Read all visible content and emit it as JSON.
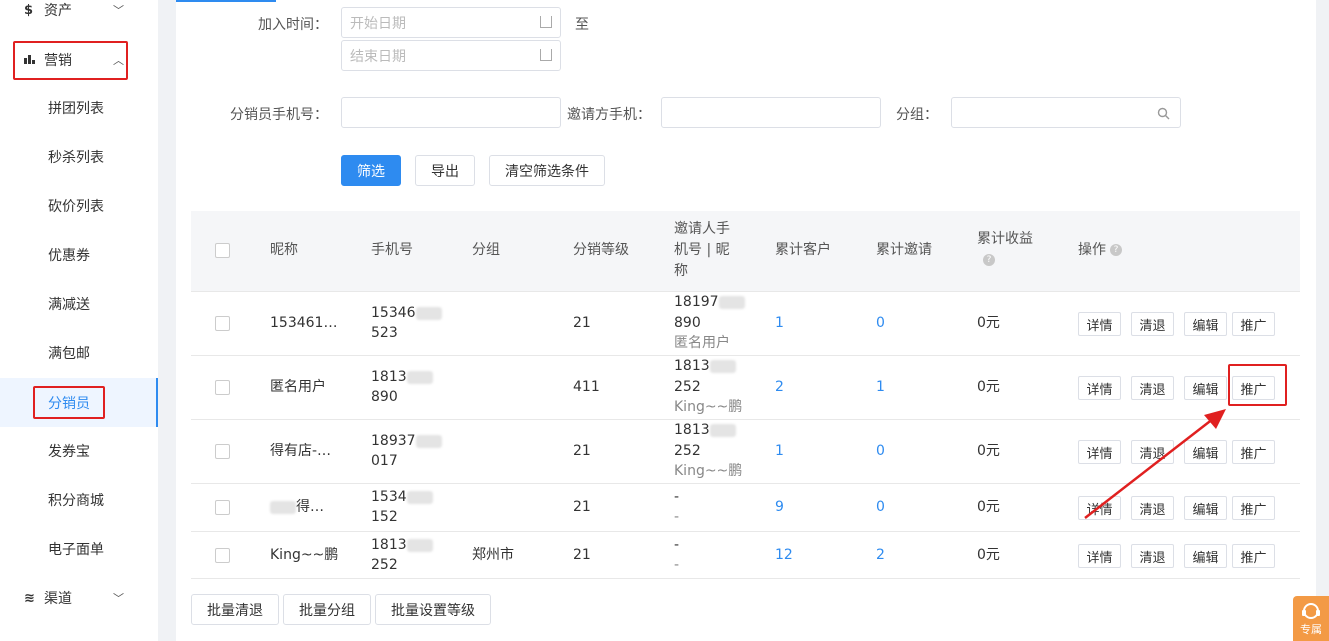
{
  "sidebar": {
    "top_items": [
      {
        "icon": "dollar-icon",
        "label": "资产",
        "expanded": false
      },
      {
        "icon": "bar-chart-icon",
        "label": "营销",
        "expanded": true
      },
      {
        "icon": "layers-icon",
        "label": "渠道",
        "expanded": false
      }
    ],
    "sub_items": [
      "拼团列表",
      "秒杀列表",
      "砍价列表",
      "优惠券",
      "满减送",
      "满包邮",
      "分销员",
      "发券宝",
      "积分商城",
      "电子面单"
    ],
    "active": "分销员"
  },
  "filters": {
    "join_time_label": "加入时间：",
    "start_date_placeholder": "开始日期",
    "to_label": "至",
    "end_date_placeholder": "结束日期",
    "phone_label": "分销员手机号：",
    "inviter_phone_label": "邀请方手机：",
    "group_label": "分组：",
    "filter_button": "筛选",
    "export_button": "导出",
    "clear_button": "清空筛选条件"
  },
  "table": {
    "headers": {
      "nickname": "昵称",
      "phone": "手机号",
      "group": "分组",
      "level": "分销等级",
      "inviter_l1": "邀请人手",
      "inviter_l2": "机号 | 昵",
      "inviter_l3": "称",
      "customers": "累计客户",
      "invites": "累计邀请",
      "income": "累计收益",
      "actions": "操作"
    },
    "rows": [
      {
        "nickname": "153461…",
        "phone_a": "15346",
        "phone_b": "523",
        "group": "",
        "level": "21",
        "inviter_a": "18197",
        "inviter_b": "890",
        "inviter_c": "匿名用户",
        "customers": "1",
        "invites": "0",
        "income": "0元"
      },
      {
        "nickname": "匿名用户",
        "phone_a": "1813",
        "phone_b": "890",
        "group": "",
        "level": "411",
        "inviter_a": "1813",
        "inviter_b": "252",
        "inviter_c": "King~~鹏",
        "customers": "2",
        "invites": "1",
        "income": "0元"
      },
      {
        "nickname": "得有店-…",
        "phone_a": "18937",
        "phone_b": "017",
        "group": "",
        "level": "21",
        "inviter_a": "1813",
        "inviter_b": "252",
        "inviter_c": "King~~鹏",
        "customers": "1",
        "invites": "0",
        "income": "0元"
      },
      {
        "nickname": "得…",
        "phone_a": "1534",
        "phone_b": "152",
        "group": "",
        "level": "21",
        "inviter_a": "-",
        "inviter_b": "-",
        "inviter_c": "",
        "customers": "9",
        "invites": "0",
        "income": "0元"
      },
      {
        "nickname": "King~~鹏",
        "phone_a": "1813",
        "phone_b": "252",
        "group": "郑州市",
        "level": "21",
        "inviter_a": "-",
        "inviter_b": "-",
        "inviter_c": "",
        "customers": "12",
        "invites": "2",
        "income": "0元"
      }
    ],
    "row_actions": {
      "detail": "详情",
      "clear": "清退",
      "edit": "编辑",
      "promote": "推广"
    }
  },
  "bulk": {
    "clear": "批量清退",
    "group": "批量分组",
    "level": "批量设置等级"
  },
  "help_widget": {
    "label": "专属"
  },
  "colors": {
    "accent": "#2e8bf0",
    "highlight": "#e02020"
  }
}
